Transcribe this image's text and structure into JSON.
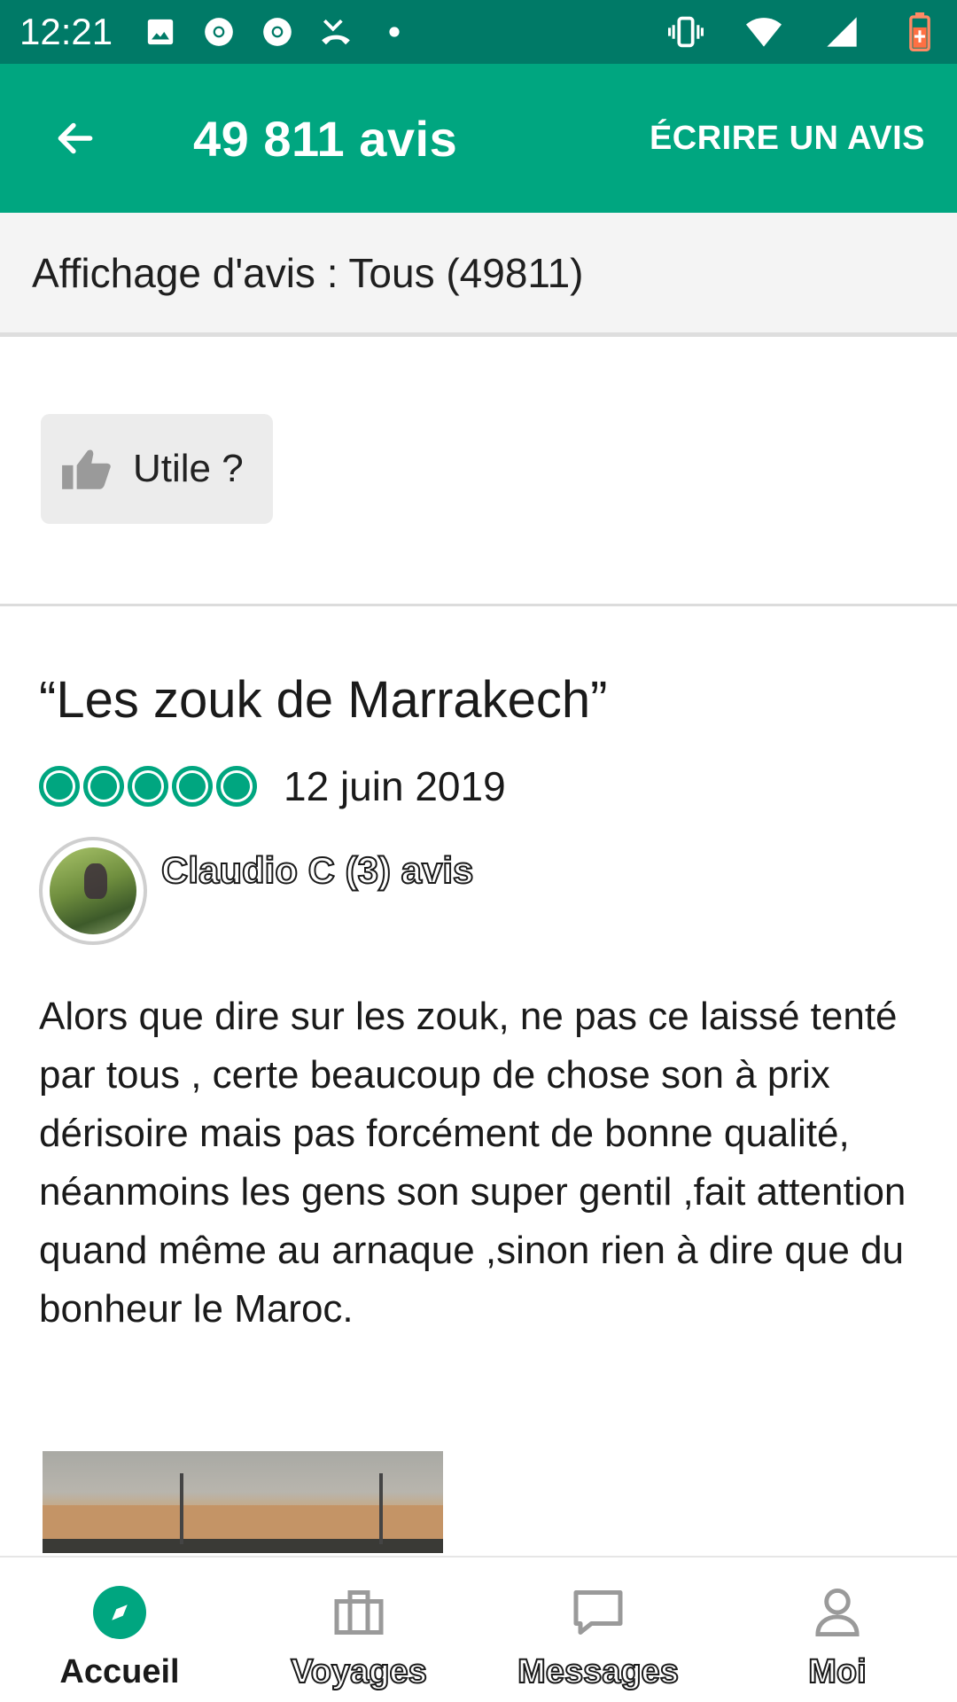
{
  "status_bar": {
    "time": "12:21",
    "left_icons": [
      "image-icon",
      "chrome-icon",
      "chrome-icon",
      "missed-call-icon",
      "dot-icon"
    ],
    "right_icons": [
      "vibrate-icon",
      "wifi-icon",
      "signal-icon",
      "battery-icon"
    ]
  },
  "app_bar": {
    "title": "49 811 avis",
    "action_label": "ÉCRIRE UN AVIS"
  },
  "filter": {
    "label": "Affichage d'avis : Tous (49811)"
  },
  "helpful_button": {
    "label": "Utile ?"
  },
  "review": {
    "title": "“Les zouk de Marrakech”",
    "rating": 5,
    "rating_max": 5,
    "date": "12 juin 2019",
    "author": "Claudio C (3) avis",
    "text": "Alors que dire sur les zouk,  ne pas ce laissé tenté par tous , certe beaucoup de chose son à prix dérisoire mais pas forcément de bonne qualité,  néanmoins les gens son super gentil ,fait attention quand même au arnaque ,sinon rien à dire que du bonheur le Maroc."
  },
  "bottom_nav": {
    "items": [
      {
        "label": "Accueil",
        "icon": "compass-icon",
        "active": true
      },
      {
        "label": "Voyages",
        "icon": "briefcase-icon",
        "active": false
      },
      {
        "label": "Messages",
        "icon": "message-icon",
        "active": false
      },
      {
        "label": "Moi",
        "icon": "person-icon",
        "active": false
      }
    ]
  },
  "colors": {
    "status_bar": "#007a67",
    "app_bar": "#00a680",
    "accent": "#00a680"
  }
}
